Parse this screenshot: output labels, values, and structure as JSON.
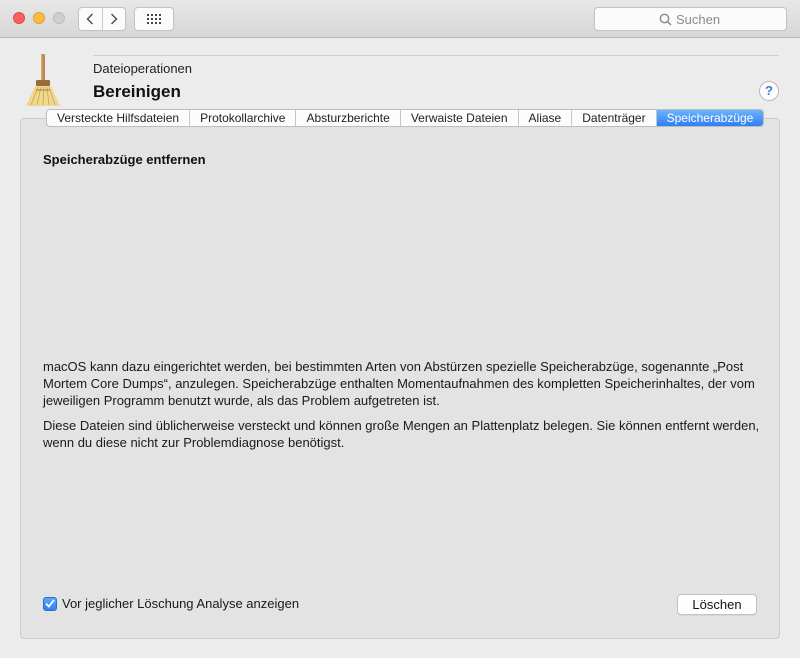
{
  "toolbar": {
    "search_placeholder": "Suchen"
  },
  "header": {
    "category": "Dateioperationen",
    "title": "Bereinigen",
    "help": "?"
  },
  "tabs": [
    {
      "label": "Versteckte Hilfsdateien",
      "active": false
    },
    {
      "label": "Protokollarchive",
      "active": false
    },
    {
      "label": "Absturzberichte",
      "active": false
    },
    {
      "label": "Verwaiste Dateien",
      "active": false
    },
    {
      "label": "Aliase",
      "active": false
    },
    {
      "label": "Datenträger",
      "active": false
    },
    {
      "label": "Speicherabzüge",
      "active": true
    }
  ],
  "content": {
    "section_title": "Speicherabzüge entfernen",
    "paragraph1": "macOS kann dazu eingerichtet werden, bei bestimmten Arten von Abstürzen spezielle Speicherabzüge, sogenannte „Post Mortem Core Dumps“, anzulegen. Speicherabzüge enthalten Momentaufnahmen des kompletten Speicherinhaltes, der vom jeweiligen Programm benutzt wurde, als das Problem aufgetreten ist.",
    "paragraph2": "Diese Dateien sind üblicherweise versteckt und können große Mengen an Plattenplatz belegen. Sie können entfernt werden, wenn du diese nicht zur Problemdiagnose benötigst."
  },
  "footer": {
    "checkbox_label": "Vor jeglicher Löschung Analyse anzeigen",
    "checkbox_checked": true,
    "delete_button": "Löschen"
  },
  "colors": {
    "accent": "#2f7ff5",
    "close": "#fc605c",
    "minimize": "#fdbc40"
  }
}
